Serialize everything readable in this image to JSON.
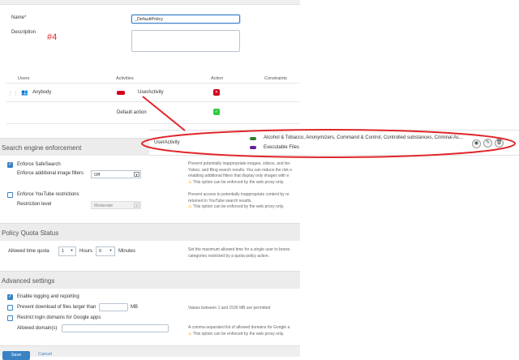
{
  "form": {
    "name_label": "Name",
    "name_required": "*",
    "name_value": "_DefaultPolicy",
    "description_label": "Description",
    "description_value": "",
    "annotation": "#4"
  },
  "rules_table": {
    "headers": [
      "Users",
      "Activities",
      "Action",
      "Constraints"
    ],
    "row": {
      "user": "Anybody",
      "activity": "UserActivity"
    },
    "default_action": "Default action"
  },
  "activity_popup": {
    "name": "UserActivity",
    "line1": "Alcohol & Tobacco, Anonymizers, Command & Control, Controlled substances, Criminal Ac...",
    "line2": "Executable Files",
    "tag1": "cat",
    "tag2": "file"
  },
  "search_engine": {
    "title": "Search engine enforcement",
    "safesearch_label": "Enforce SafeSearch",
    "image_filters_label": "Enforce additional image filters",
    "image_filters_value": "Off",
    "desc1": "Prevent potentially inappropriate images, videos, and tex",
    "desc2": "Yahoo, and Bing search results. You can reduce the risk o",
    "desc3": "enabling additional filters that display only images with e",
    "warn1": "This option can be enforced by the web proxy only.",
    "youtube_label": "Enforce YouTube restrictions",
    "restriction_label": "Restriction level",
    "restriction_value": "Moderate",
    "ydesc1": "Prevent access to potentially inappropriate content by re",
    "ydesc2": "returned in YouTube search results.",
    "warn2": "This option can be enforced by the web proxy only."
  },
  "quota": {
    "title": "Policy Quota Status",
    "allowed_label": "Allowed time quota",
    "hours_value": "1",
    "hours_label": "Hours",
    "minutes_value": "0",
    "minutes_label": "Minutes",
    "desc1": "Set the maximum allowed time for a single user to brows",
    "desc2": "categories restricted by a quota policy action."
  },
  "advanced": {
    "title": "Advanced settings",
    "logging_label": "Enable logging and reporting",
    "prevent_download_label": "Prevent download of files larger than",
    "size_unit": "MB",
    "size_desc": "Values between 1 and 1536 MB are permitted",
    "restrict_login_label": "Restrict login domains for Google apps",
    "allowed_domains_label": "Allowed domain(s)",
    "domains_desc": "A comma-separated list of allowed domains for Google a",
    "warn3": "This option can be enforced by the web proxy only."
  },
  "footer": {
    "save": "Save",
    "cancel": "Cancel"
  },
  "colors": {
    "accent": "#3a82c4",
    "annotation": "#e0262a",
    "block": "#d0021b",
    "allow": "#2ecc40"
  }
}
